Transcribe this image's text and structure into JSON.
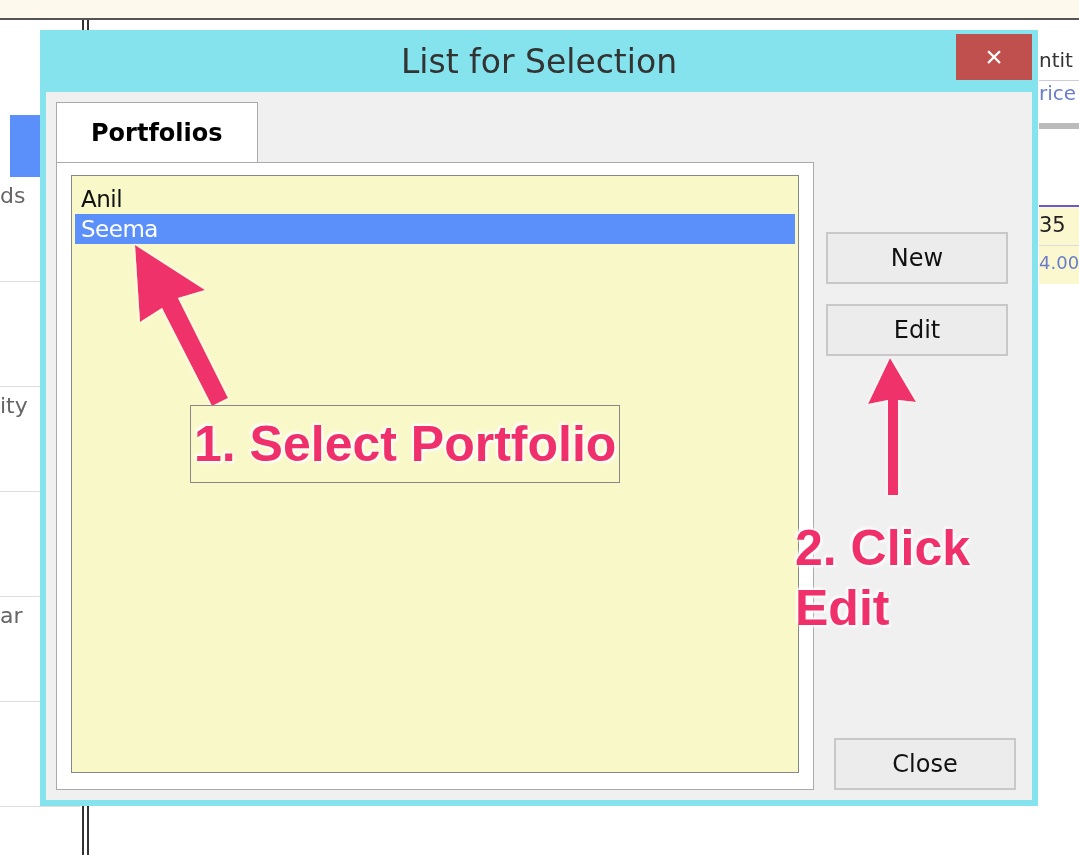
{
  "background": {
    "left_labels": [
      "ds",
      "ity",
      "ar"
    ],
    "right_labels": [
      "ntit",
      "rice"
    ],
    "right_cells": [
      "35",
      "4.00"
    ]
  },
  "dialog": {
    "title": "List for Selection",
    "close_symbol": "×",
    "tabs": [
      {
        "label": "Portfolios",
        "selected": true
      }
    ],
    "items": [
      {
        "label": "Anil",
        "selected": false
      },
      {
        "label": "Seema",
        "selected": true
      }
    ],
    "buttons": [
      {
        "label": "New",
        "kind": "top"
      },
      {
        "label": "Edit",
        "kind": "top"
      },
      {
        "label": "Close",
        "kind": "bottom"
      }
    ]
  },
  "annotations": [
    {
      "text": "1. Select Portfolio",
      "kind": "list"
    },
    {
      "text": "2. Click Edit",
      "kind": "button"
    }
  ]
}
